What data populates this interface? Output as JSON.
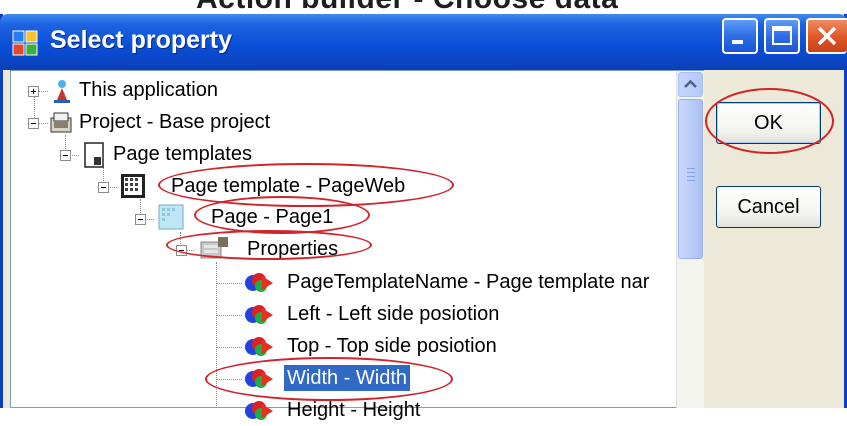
{
  "background_heading": "Action builder - Choose data",
  "window": {
    "title": "Select property",
    "buttons": {
      "minimize": "minimize",
      "maximize": "maximize",
      "close": "close"
    }
  },
  "tree": {
    "nodes": [
      {
        "label": "This application",
        "icon": "application-icon",
        "expander": "plus"
      },
      {
        "label": "Project - Base project",
        "icon": "project-icon",
        "expander": "minus"
      },
      {
        "label": "Page templates",
        "icon": "page-templates-icon",
        "expander": "minus"
      },
      {
        "label": "Page template - PageWeb",
        "icon": "page-template-icon",
        "expander": "minus"
      },
      {
        "label": "Page - Page1",
        "icon": "page-icon",
        "expander": "minus"
      },
      {
        "label": "Properties",
        "icon": "properties-icon",
        "expander": "minus"
      },
      {
        "label": "PageTemplateName - Page template nar",
        "icon": "property-icon"
      },
      {
        "label": "Left - Left side posiotion",
        "icon": "property-icon"
      },
      {
        "label": "Top - Top side posiotion",
        "icon": "property-icon"
      },
      {
        "label": "Width - Width",
        "icon": "property-icon",
        "selected": true
      },
      {
        "label": "Height - Height",
        "icon": "property-icon"
      }
    ]
  },
  "actions": {
    "ok_label": "OK",
    "cancel_label": "Cancel"
  },
  "colors": {
    "annotation": "#d0242a",
    "selection": "#316ac5",
    "titlebar": "#0a4fd8"
  }
}
